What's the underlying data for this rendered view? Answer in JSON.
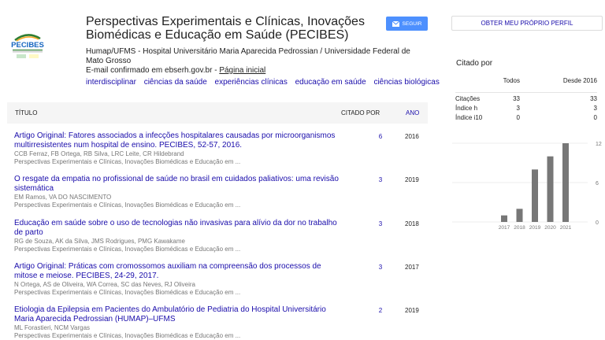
{
  "profile": {
    "name": "Perspectivas Experimentais e Clínicas, Inovações Biomédicas e Educação em Saúde (PECIBES)",
    "affiliation": "Humap/UFMS - Hospital Universitário Maria Aparecida Pedrossian / Universidade Federal de Mato Grosso",
    "email": "E-mail confirmado em ebserh.gov.br",
    "email_separator": " - ",
    "homepage_link": "Página inicial",
    "interests": [
      "interdisciplinar",
      "ciências da saúde",
      "experiências clínicas",
      "educação em saúde",
      "ciências biológicas"
    ],
    "logo_text": "PECIBES",
    "follow_label": "SEGUIR",
    "own_profile_label": "OBTER MEU PRÓPRIO PERFIL"
  },
  "table": {
    "col_title": "TÍTULO",
    "col_cited": "CITADO POR",
    "col_year": "ANO"
  },
  "articles": [
    {
      "title": "Artigo Original: Fatores associados a infecções hospitalares causadas por microorganismos multirresistentes num hospital de ensino. PECIBES, 52-57, 2016.",
      "authors": "CCB Ferraz, FB Ortega, RB Silva, LRC Leite, CR Hildebrand",
      "venue": "Perspectivas Experimentais e Clínicas, Inovações Biomédicas e Educação em ...",
      "cites": "6",
      "year": "2016"
    },
    {
      "title": "O resgate da empatia no profissional de saúde no brasil em cuidados paliativos: uma revisão sistemática",
      "authors": "EM Ramos, VA DO NASCIMENTO",
      "venue": "Perspectivas Experimentais e Clínicas, Inovações Biomédicas e Educação em ...",
      "cites": "3",
      "year": "2019"
    },
    {
      "title": "Educação em saúde sobre o uso de tecnologias não invasivas para alívio da dor no trabalho de parto",
      "authors": "RG de Souza, AK da Silva, JMS Rodrigues, PMG Kawakame",
      "venue": "Perspectivas Experimentais e Clínicas, Inovações Biomédicas e Educação em ...",
      "cites": "3",
      "year": "2018"
    },
    {
      "title": "Artigo Original: Práticas com cromossomos auxiliam na compreensão dos processos de mitose e meiose. PECIBES, 24-29, 2017.",
      "authors": "N Ortega, AS de Oliveira, WA Correa, SC das Neves, RJ Oliveira",
      "venue": "Perspectivas Experimentais e Clínicas, Inovações Biomédicas e Educação em ...",
      "cites": "3",
      "year": "2017"
    },
    {
      "title": "Etiologia da Epilepsia em Pacientes do Ambulatório de Pediatria do Hospital Universitário Maria Aparecida Pedrossian (HUMAP)–UFMS",
      "authors": "ML Forastieri, NCM Vargas",
      "venue": "Perspectivas Experimentais e Clínicas, Inovações Biomédicas e Educação em ...",
      "cites": "2",
      "year": "2019"
    }
  ],
  "citations": {
    "title": "Citado por",
    "col_all": "Todos",
    "col_since": "Desde 2016",
    "rows": [
      {
        "label": "Citações",
        "all": "33",
        "since": "33"
      },
      {
        "label": "Índice h",
        "all": "3",
        "since": "3"
      },
      {
        "label": "Índice i10",
        "all": "0",
        "since": "0"
      }
    ]
  },
  "chart_data": {
    "type": "bar",
    "categories": [
      "2017",
      "2018",
      "2019",
      "2020",
      "2021"
    ],
    "values": [
      1,
      2,
      8,
      10,
      12
    ],
    "ylim": [
      0,
      12
    ],
    "yticks": [
      0,
      6,
      12
    ],
    "bar_color": "#777777"
  }
}
